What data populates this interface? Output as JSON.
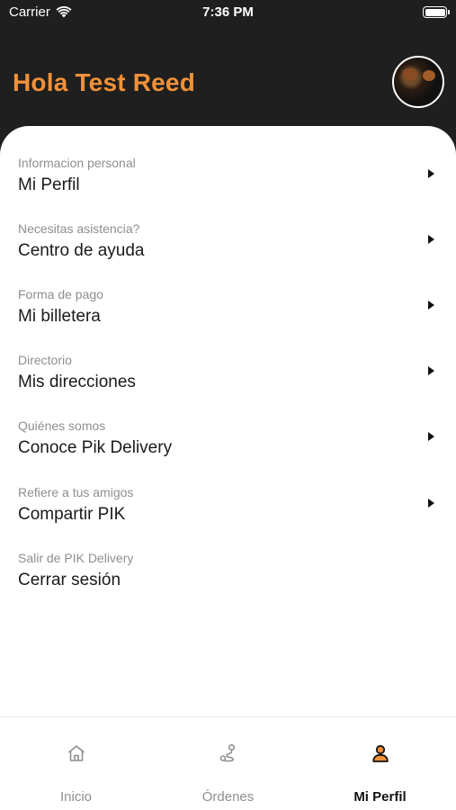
{
  "status_bar": {
    "carrier": "Carrier",
    "time": "7:36 PM",
    "wifi_icon": "wifi-icon",
    "battery_icon": "battery-icon"
  },
  "header": {
    "greeting": "Hola Test Reed",
    "greeting_color": "#f0913a",
    "background_color": "#1f1f1f"
  },
  "menu": [
    {
      "subtitle": "Informacion personal",
      "title": "Mi Perfil",
      "has_arrow": true
    },
    {
      "subtitle": "Necesitas asistencia?",
      "title": "Centro de ayuda",
      "has_arrow": true
    },
    {
      "subtitle": "Forma de pago",
      "title": "Mi billetera",
      "has_arrow": true
    },
    {
      "subtitle": "Directorio",
      "title": "Mis direcciones",
      "has_arrow": true
    },
    {
      "subtitle": "Quiénes somos",
      "title": "Conoce Pik Delivery",
      "has_arrow": true
    },
    {
      "subtitle": "Refiere a tus amigos",
      "title": "Compartir PIK",
      "has_arrow": true
    },
    {
      "subtitle": "Salir de PIK Delivery",
      "title": "Cerrar sesión",
      "has_arrow": false
    }
  ],
  "tabbar": {
    "tabs": [
      {
        "label": "Inicio",
        "icon": "home-icon",
        "active": false
      },
      {
        "label": "Órdenes",
        "icon": "route-icon",
        "active": false
      },
      {
        "label": "Mi Perfil",
        "icon": "user-icon",
        "active": true
      }
    ],
    "accent_color": "#f0913a"
  }
}
